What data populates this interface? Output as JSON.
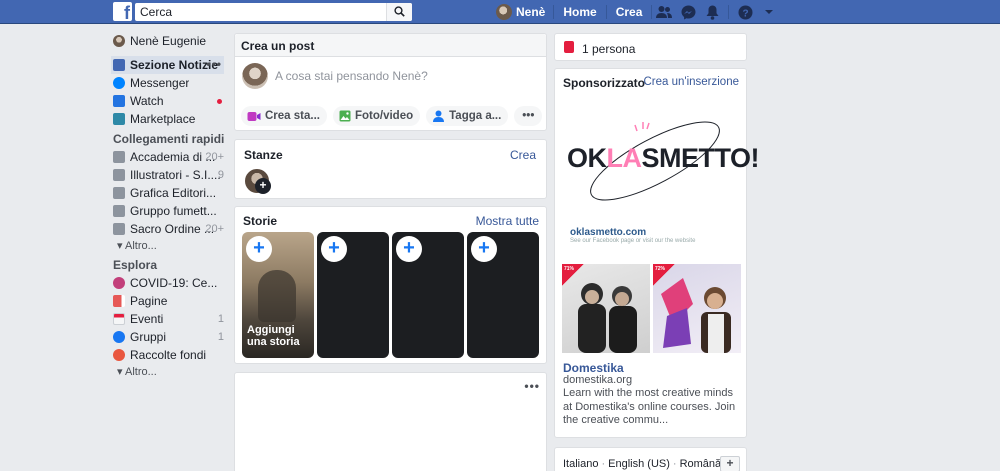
{
  "topbar": {
    "logo": "f",
    "search_placeholder": "Cerca",
    "user_name": "Nenè",
    "home": "Home",
    "create": "Crea",
    "icons": [
      "friend-requests-icon",
      "messenger-icon",
      "notifications-icon",
      "help-icon",
      "account-menu-icon"
    ]
  },
  "sidebar": {
    "profile": "Nenè Eugenie",
    "main_items": [
      {
        "label": "Sezione Notizie",
        "icon": "news-feed-icon",
        "more": "•••"
      },
      {
        "label": "Messenger",
        "icon": "messenger-icon"
      },
      {
        "label": "Watch",
        "icon": "watch-icon"
      },
      {
        "label": "Marketplace",
        "icon": "marketplace-icon"
      }
    ],
    "shortcuts_title": "Collegamenti rapidi",
    "shortcuts": [
      {
        "label": "Accademia di ...",
        "count": "20+"
      },
      {
        "label": "Illustratori - S.I....",
        "count": "9"
      },
      {
        "label": "Grafica Editori...",
        "count": ""
      },
      {
        "label": "Gruppo fumett...",
        "count": ""
      },
      {
        "label": "Sacro Ordine ...",
        "count": "20+"
      }
    ],
    "shortcuts_more": "Altro...",
    "explore_title": "Esplora",
    "explore": [
      {
        "label": "COVID-19: Ce...",
        "count": "",
        "icon": "covid-icon"
      },
      {
        "label": "Pagine",
        "count": "",
        "icon": "flag-icon"
      },
      {
        "label": "Eventi",
        "count": "1",
        "icon": "calendar-icon"
      },
      {
        "label": "Gruppi",
        "count": "1",
        "icon": "groups-icon"
      },
      {
        "label": "Raccolte fondi",
        "count": "",
        "icon": "fundraiser-icon"
      }
    ],
    "explore_more": "Altro..."
  },
  "composer": {
    "title": "Crea un post",
    "placeholder": "A cosa stai pensando Nenè?",
    "actions": [
      "Crea sta...",
      "Foto/video",
      "Tagga a...",
      "•••"
    ]
  },
  "rooms": {
    "title": "Stanze",
    "create": "Crea"
  },
  "stories": {
    "title": "Storie",
    "show_all": "Mostra tutte",
    "add_story": "Aggiungi una storia"
  },
  "feed": {
    "more": "•••"
  },
  "right": {
    "people": "1 persona",
    "sponsored": "Sponsorizzato",
    "create_ad": "Crea un'inserzione",
    "ad": {
      "logo_parts": [
        "OK",
        "LA",
        "SMETTO!"
      ],
      "domain_text": "oklasmetto.com",
      "sub_text": "See our Facebook page or visit our the website",
      "badge_left": "71%",
      "badge_right": "72%",
      "title": "Domestika",
      "url": "domestika.org",
      "description": "Learn with the most creative minds at Domestika's online courses. Join the creative commu..."
    },
    "languages": [
      "Italiano",
      "English (US)",
      "Română"
    ],
    "add_language": "+"
  },
  "colors": {
    "brand": "#4267b2",
    "link": "#385898",
    "story_plus": "#1877f2",
    "alert": "#e41e3f"
  }
}
